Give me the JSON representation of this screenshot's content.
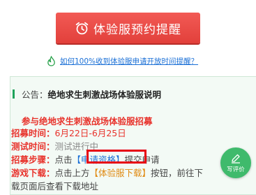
{
  "header": {
    "remind_button_label": "体验服预约提醒"
  },
  "faq": {
    "link_text": "如何100%收到体验服申请开放时间提醒？"
  },
  "notice": {
    "prefix": "公告：",
    "title": "绝地求生刺激战场体验服说明",
    "subtitle": "参与绝地求生刺激战场体验服招募",
    "recruit_time": {
      "key": "招募时间：",
      "value": "6月22日-6月25日"
    },
    "test_time": {
      "key": "测试时间：",
      "value": "测试进行中"
    },
    "steps": {
      "key": "招募步骤：",
      "pre": "点击",
      "link": "【申请资格】",
      "post": "提交申请"
    },
    "download": {
      "key": "游戏下载：",
      "pre": "点击上方",
      "link": "【体验服下载】",
      "post": "按钮，前往下"
    },
    "cut_line": "载页面后查看下载地址"
  },
  "review_button": {
    "label": "写评价"
  }
}
